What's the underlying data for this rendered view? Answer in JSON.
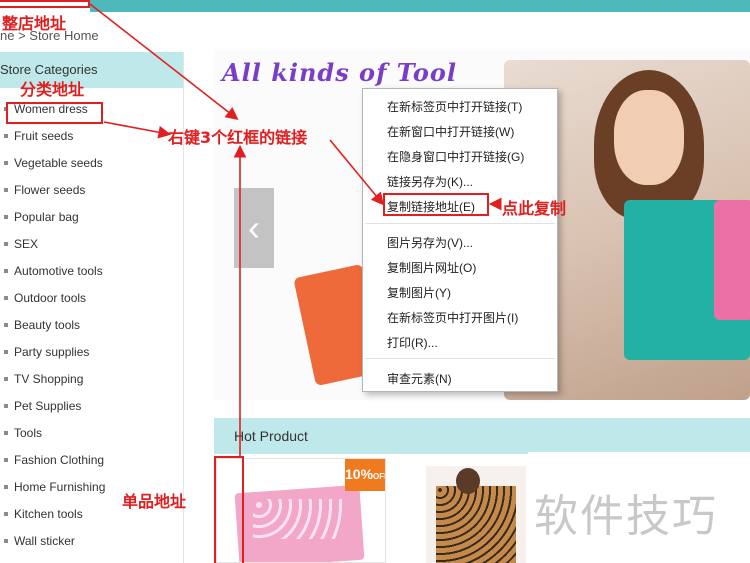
{
  "breadcrumb": "ne > Store Home",
  "sidebar": {
    "title": "Store Categories",
    "items": [
      {
        "label": "Women dress"
      },
      {
        "label": "Fruit seeds"
      },
      {
        "label": "Vegetable seeds"
      },
      {
        "label": "Flower seeds"
      },
      {
        "label": "Popular bag"
      },
      {
        "label": "SEX"
      },
      {
        "label": "Automotive tools"
      },
      {
        "label": "Outdoor tools"
      },
      {
        "label": "Beauty tools"
      },
      {
        "label": "Party supplies"
      },
      {
        "label": "TV Shopping"
      },
      {
        "label": "Pet Supplies"
      },
      {
        "label": "Tools"
      },
      {
        "label": "Fashion Clothing"
      },
      {
        "label": "Home Furnishing"
      },
      {
        "label": "Kitchen tools"
      },
      {
        "label": "Wall sticker"
      }
    ]
  },
  "banner": {
    "title": "All kinds of Tool",
    "prev_icon": "‹"
  },
  "hot_product": {
    "title": "Hot Product",
    "badge": "10%",
    "badge_sub": "OFF"
  },
  "context_menu": {
    "items": [
      "在新标签页中打开链接(T)",
      "在新窗口中打开链接(W)",
      "在隐身窗口中打开链接(G)",
      "链接另存为(K)...",
      "复制链接地址(E)",
      "图片另存为(V)...",
      "复制图片网址(O)",
      "复制图片(Y)",
      "在新标签页中打开图片(I)",
      "打印(R)...",
      "审查元素(N)"
    ]
  },
  "annotations": {
    "store_address": "整店地址",
    "category_address": "分类地址",
    "right_click_note": "右键3个红框的链接",
    "copy_here": "点此复制",
    "product_address": "单品地址",
    "color": "#e02020"
  },
  "watermark": "软件技巧"
}
